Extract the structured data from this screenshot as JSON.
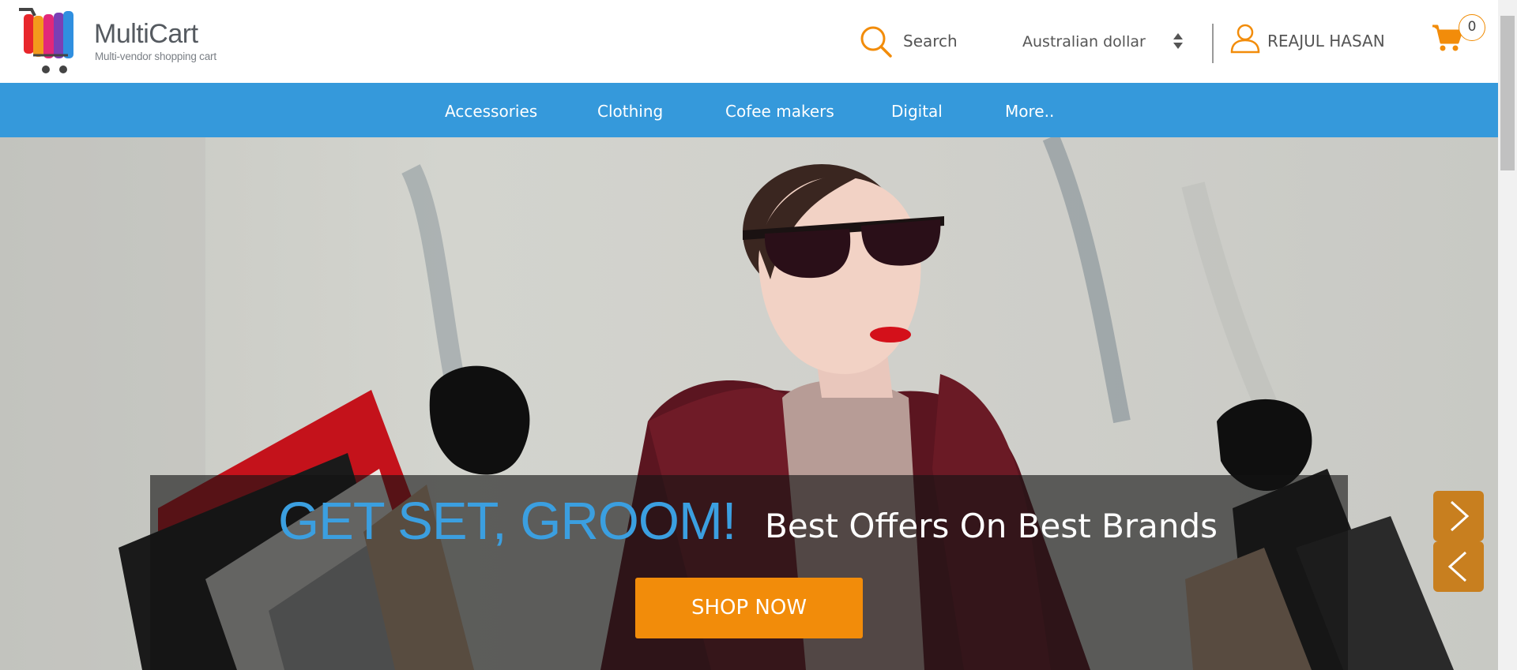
{
  "brand": {
    "name": "MultiCart",
    "tagline": "Multi-vendor shopping cart"
  },
  "header": {
    "search_label": "Search",
    "currency": "Australian dollar",
    "account_name": "REAJUL HASAN",
    "cart_count": "0"
  },
  "nav": {
    "items": [
      {
        "label": "Accessories"
      },
      {
        "label": "Clothing"
      },
      {
        "label": "Cofee makers"
      },
      {
        "label": "Digital"
      },
      {
        "label": "More.."
      }
    ]
  },
  "hero": {
    "title": "GET SET, GROOM!",
    "subtitle": "Best Offers On Best Brands",
    "cta_label": "SHOP NOW"
  },
  "colors": {
    "brand_orange": "#f28c0a",
    "nav_blue": "#3599db",
    "title_blue": "#3b9fe0"
  },
  "icons": {
    "search": "search-icon",
    "currency_toggle": "sort-arrows-icon",
    "account": "user-icon",
    "cart": "shopping-cart-icon",
    "next": "chevron-right-icon",
    "prev": "chevron-left-icon"
  }
}
